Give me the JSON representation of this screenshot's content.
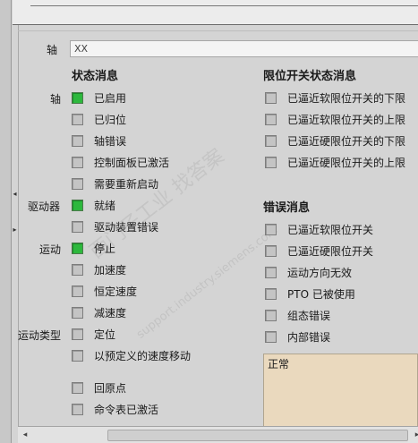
{
  "axis": {
    "label": "轴",
    "value": "XX"
  },
  "status": {
    "title": "状态消息",
    "groups": [
      {
        "label": "轴",
        "items": [
          {
            "label": "已启用",
            "on": true
          },
          {
            "label": "已归位",
            "on": false
          },
          {
            "label": "轴错误",
            "on": false
          },
          {
            "label": "控制面板已激活",
            "on": false
          },
          {
            "label": "需要重新启动",
            "on": false
          }
        ]
      },
      {
        "label": "驱动器",
        "items": [
          {
            "label": "就绪",
            "on": true
          },
          {
            "label": "驱动装置错误",
            "on": false
          }
        ]
      },
      {
        "label": "运动",
        "items": [
          {
            "label": "停止",
            "on": true
          },
          {
            "label": "加速度",
            "on": false
          },
          {
            "label": "恒定速度",
            "on": false
          },
          {
            "label": "减速度",
            "on": false
          }
        ]
      },
      {
        "label": "运动类型",
        "items": [
          {
            "label": "定位",
            "on": false
          },
          {
            "label": "以预定义的速度移动",
            "on": false
          },
          {
            "label": "回原点",
            "on": false
          },
          {
            "label": "命令表已激活",
            "on": false
          }
        ]
      }
    ]
  },
  "limits": {
    "title": "限位开关状态消息",
    "items": [
      {
        "label": "已逼近软限位开关的下限",
        "on": false
      },
      {
        "label": "已逼近软限位开关的上限",
        "on": false
      },
      {
        "label": "已逼近硬限位开关的下限",
        "on": false
      },
      {
        "label": "已逼近硬限位开关的上限",
        "on": false
      }
    ]
  },
  "errors": {
    "title": "错误消息",
    "items": [
      {
        "label": "已逼近软限位开关",
        "on": false
      },
      {
        "label": "已逼近硬限位开关",
        "on": false
      },
      {
        "label": "运动方向无效",
        "on": false
      },
      {
        "label": "PTO 已被使用",
        "on": false
      },
      {
        "label": "组态错误",
        "on": false
      },
      {
        "label": "内部错误",
        "on": false
      }
    ]
  },
  "message_box": {
    "text": "正常"
  },
  "watermark": {
    "text": "西门子工业 找答案",
    "url": "support.industry.siemens.com"
  },
  "colors": {
    "led_on": "#2db83d",
    "led_off": "#c4c4c4",
    "message_bg": "#ead9be"
  }
}
